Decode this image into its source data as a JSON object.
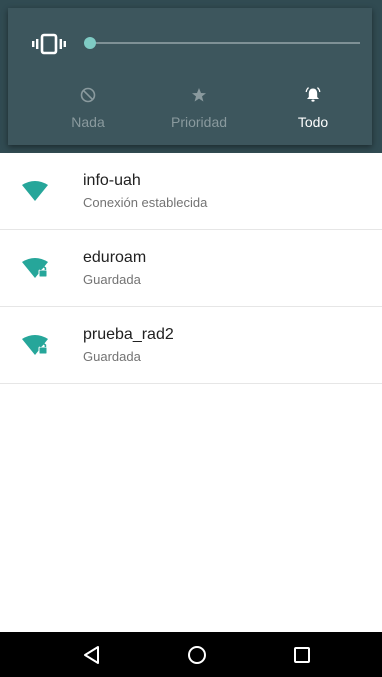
{
  "volume_panel": {
    "ringer_mode_icon": "vibrate-icon",
    "slider_level": 0.0,
    "accent_color": "#7fcbc4",
    "modes": [
      {
        "label": "Nada",
        "icon": "block-icon",
        "active": false
      },
      {
        "label": "Prioridad",
        "icon": "star-icon",
        "active": false
      },
      {
        "label": "Todo",
        "icon": "bell-icon",
        "active": true
      }
    ]
  },
  "wifi_networks": [
    {
      "ssid": "info-uah",
      "status": "Conexión establecida",
      "secured": false
    },
    {
      "ssid": "eduroam",
      "status": "Guardada",
      "secured": true
    },
    {
      "ssid": "prueba_rad2",
      "status": "Guardada",
      "secured": true
    }
  ],
  "wifi_icon_color": "#26a69a",
  "nav_bar": {
    "buttons": [
      "back-icon",
      "home-icon",
      "recents-icon"
    ]
  }
}
